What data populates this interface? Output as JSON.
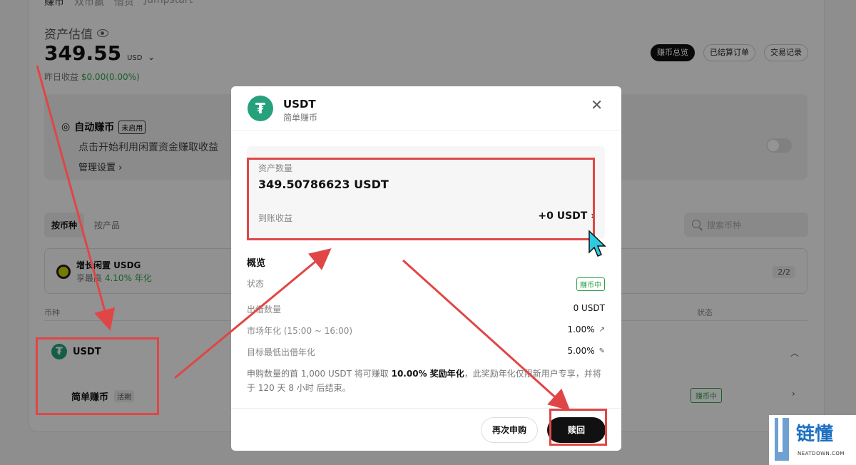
{
  "background": {
    "nav": [
      "赚币",
      "双币赢",
      "借贷",
      "Jumpstart"
    ],
    "asset_label": "资产估值",
    "asset_value": "349.55",
    "asset_currency": "USD",
    "yesterday_label": "昨日收益",
    "yesterday_value": "$0.00(0.00%)",
    "top_buttons": [
      "赚币总览",
      "已结算订单",
      "交易记录"
    ],
    "auto_earn": {
      "title": "自动赚币",
      "tag": "未启用",
      "desc": "点击开始利用闲置资金赚取收益",
      "link": "管理设置"
    },
    "tabs": [
      "按币种",
      "按产品"
    ],
    "search_placeholder": "搜索币种",
    "promo": {
      "title": "增长闲置 USDG",
      "sub_prefix": "享最高",
      "sub_rate": "4.10% 年化",
      "page": "2/2"
    },
    "columns": [
      "币种",
      "状态"
    ],
    "coin": "USDT",
    "product": "简单赚币",
    "product_tag": "活期",
    "product_status": "赚币中"
  },
  "modal": {
    "title": "USDT",
    "subtitle": "简单赚币",
    "balance_label": "资产数量",
    "balance_value": "349.50786623 USDT",
    "earn_label": "到账收益",
    "earn_value": "+0 USDT",
    "overview_title": "概览",
    "rows": [
      {
        "label": "状态",
        "value": "赚币中"
      },
      {
        "label": "出借数量",
        "value": "0 USDT"
      },
      {
        "label": "市场年化 (15:00 ~ 16:00)",
        "value": "1.00%"
      },
      {
        "label": "目标最低出借年化",
        "value": "5.00%"
      }
    ],
    "notice_a": "申购数量的首 1,000 USDT 将可赚取 ",
    "notice_b": "10.00% 奖励年化",
    "notice_c": "，此奖励年化仅限新用户专享，并将于 120 天 8 小时 后结束。",
    "btn_again": "再次申购",
    "btn_redeem": "赎回"
  },
  "watermark": {
    "name": "链懂",
    "site": "NEATDOWN.COM"
  },
  "colors": {
    "accent_green": "#2fa24b",
    "tether": "#26a17b",
    "highlight_red": "#e04646"
  }
}
